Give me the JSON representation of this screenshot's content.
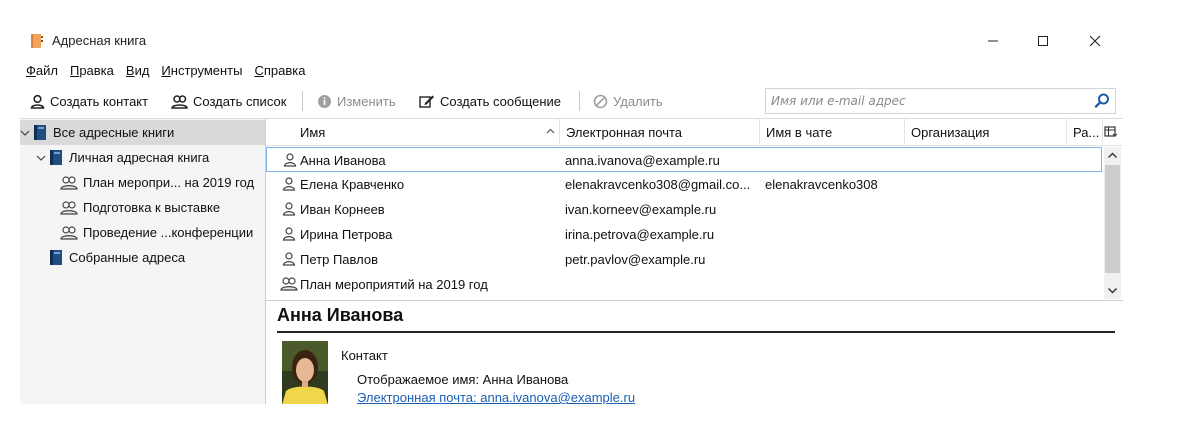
{
  "window": {
    "title": "Адресная книга",
    "controls": {
      "minimize": "–",
      "maximize": "☐",
      "close": "✕"
    }
  },
  "menu": [
    {
      "key": "Ф",
      "rest": "айл"
    },
    {
      "key": "П",
      "rest": "равка"
    },
    {
      "key": "В",
      "rest": "ид"
    },
    {
      "key": "И",
      "rest": "нструменты"
    },
    {
      "key": "С",
      "rest": "правка"
    }
  ],
  "toolbar": {
    "new_contact": "Создать контакт",
    "new_list": "Создать список",
    "edit": "Изменить",
    "write": "Создать сообщение",
    "delete": "Удалить",
    "search_placeholder": "Имя или e-mail адрес"
  },
  "tree": {
    "all_books": "Все адресные книги",
    "personal": "Личная адресная книга",
    "lists": [
      "План меропри... на 2019 год",
      "Подготовка к выставке",
      "Проведение ...конференции"
    ],
    "collected": "Собранные адреса"
  },
  "columns": {
    "name": "Имя",
    "email": "Электронная почта",
    "chat": "Имя в чате",
    "org": "Организация",
    "extra": "Ра..."
  },
  "contacts": [
    {
      "name": "Анна Иванова",
      "email": "anna.ivanova@example.ru",
      "chat": "",
      "type": "person"
    },
    {
      "name": "Елена Кравченко",
      "email": "elenakravcenko308@gmail.co...",
      "chat": "elenakravcenko308",
      "type": "person"
    },
    {
      "name": "Иван Корнеев",
      "email": "ivan.korneev@example.ru",
      "chat": "",
      "type": "person"
    },
    {
      "name": "Ирина Петрова",
      "email": "irina.petrova@example.ru",
      "chat": "",
      "type": "person"
    },
    {
      "name": "Петр Павлов",
      "email": "petr.pavlov@example.ru",
      "chat": "",
      "type": "person"
    },
    {
      "name": "План мероприятий на 2019 год",
      "email": "",
      "chat": "",
      "type": "list"
    }
  ],
  "card": {
    "name": "Анна Иванова",
    "section": "Контакт",
    "display_name": "Отображаемое имя: Анна Иванова",
    "email_line": "Электронная почта: anna.ivanova@example.ru"
  },
  "colors": {
    "selection_border": "#7eb4ea",
    "tree_selected": "#d9d9d9",
    "link": "#1a5fb4",
    "book_blue": "#1f4f82"
  }
}
